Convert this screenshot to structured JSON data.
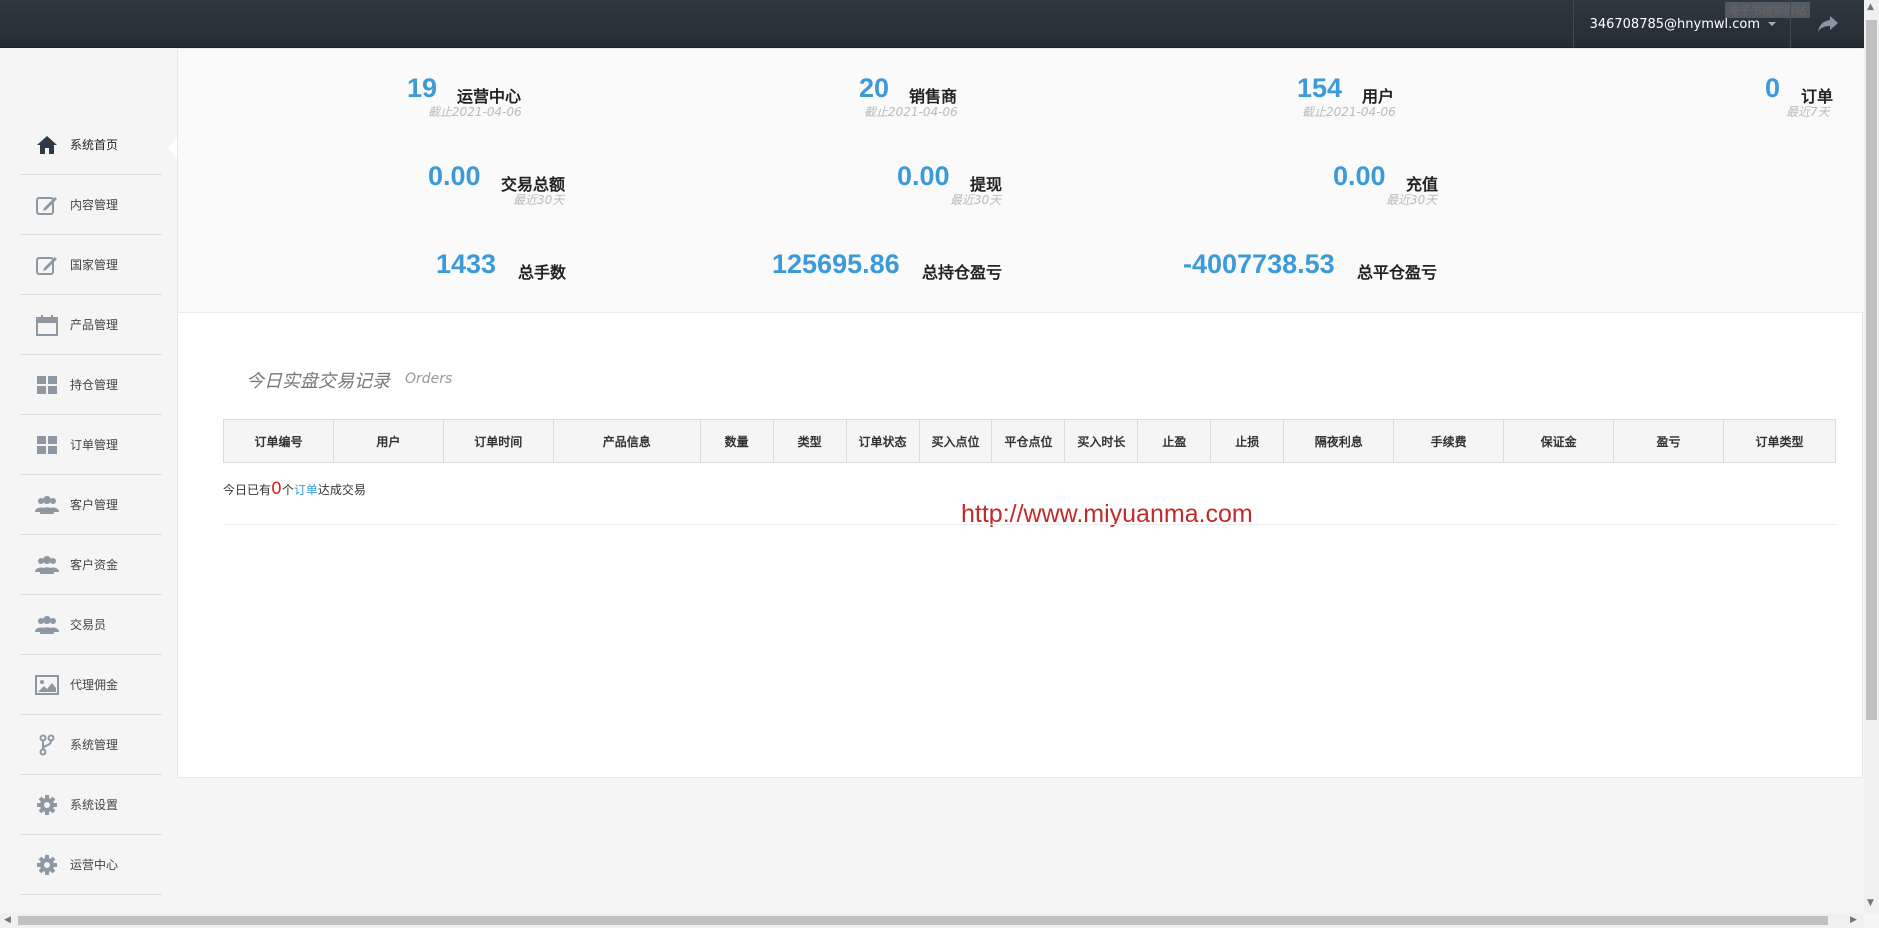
{
  "header": {
    "user_email": "346708785@hnymwl.com",
    "watermark": "电子书搜索网站"
  },
  "sidebar": {
    "items": [
      {
        "label": "系统首页",
        "icon": "home-icon"
      },
      {
        "label": "内容管理",
        "icon": "edit-icon"
      },
      {
        "label": "国家管理",
        "icon": "edit-icon"
      },
      {
        "label": "产品管理",
        "icon": "calendar-icon"
      },
      {
        "label": "持仓管理",
        "icon": "grid-icon"
      },
      {
        "label": "订单管理",
        "icon": "grid-icon"
      },
      {
        "label": "客户管理",
        "icon": "users-icon"
      },
      {
        "label": "客户资金",
        "icon": "users-icon"
      },
      {
        "label": "交易员",
        "icon": "users-icon"
      },
      {
        "label": "代理佣金",
        "icon": "image-icon"
      },
      {
        "label": "系统管理",
        "icon": "branch-icon"
      },
      {
        "label": "系统设置",
        "icon": "gear-icon"
      },
      {
        "label": "运营中心",
        "icon": "gear-icon"
      }
    ]
  },
  "stats": {
    "operation_centers": {
      "value": "19",
      "label": "运营中心",
      "sub": "截止2021-04-06"
    },
    "sellers": {
      "value": "20",
      "label": "销售商",
      "sub": "截止2021-04-06"
    },
    "users": {
      "value": "154",
      "label": "用户",
      "sub": "截止2021-04-06"
    },
    "orders": {
      "value": "0",
      "label": "订单",
      "sub": "最近7天"
    },
    "trade_total": {
      "value": "0.00",
      "label": "交易总额",
      "sub": "最近30天"
    },
    "withdraw": {
      "value": "0.00",
      "label": "提现",
      "sub": "最近30天"
    },
    "recharge": {
      "value": "0.00",
      "label": "充值",
      "sub": "最近30天"
    },
    "total_lots": {
      "value": "1433",
      "label": "总手数"
    },
    "total_position_pl": {
      "value": "125695.86",
      "label": "总持仓盈亏"
    },
    "total_close_pl": {
      "value": "-4007738.53",
      "label": "总平仓盈亏"
    }
  },
  "orders_section": {
    "title": "今日实盘交易记录",
    "subtitle": "Orders",
    "columns": [
      "订单编号",
      "用户",
      "订单时间",
      "产品信息",
      "数量",
      "类型",
      "订单状态",
      "买入点位",
      "平仓点位",
      "买入时长",
      "止盈",
      "止损",
      "隔夜利息",
      "手续费",
      "保证金",
      "盈亏",
      "订单类型"
    ],
    "summary_prefix": "今日已有",
    "summary_count": "0",
    "summary_mid": "个",
    "summary_link": "订单",
    "summary_suffix": "达成交易"
  },
  "watermark_url": "http://www.miyuanma.com",
  "colors": {
    "accent": "#3d9ad8",
    "topbar": "#2b343c",
    "danger": "#d9261c"
  }
}
